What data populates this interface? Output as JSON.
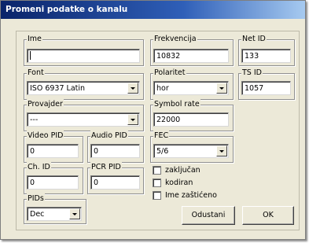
{
  "window": {
    "title": "Promeni podatke o kanalu"
  },
  "fields": {
    "ime": {
      "label": "Ime",
      "value": ""
    },
    "frekvencija": {
      "label": "Frekvencija",
      "value": "10832"
    },
    "net_id": {
      "label": "Net ID",
      "value": "133"
    },
    "font": {
      "label": "Font",
      "value": "ISO 6937 Latin"
    },
    "polaritet": {
      "label": "Polaritet",
      "value": "hor"
    },
    "ts_id": {
      "label": "TS ID",
      "value": "1057"
    },
    "provajder": {
      "label": "Provajder",
      "value": "---"
    },
    "symbol_rate": {
      "label": "Symbol rate",
      "value": "22000"
    },
    "video_pid": {
      "label": "Video PID",
      "value": "0"
    },
    "audio_pid": {
      "label": "Audio PID",
      "value": "0"
    },
    "fec": {
      "label": "FEC",
      "value": "5/6"
    },
    "ch_id": {
      "label": "Ch. ID",
      "value": "0"
    },
    "pcr_pid": {
      "label": "PCR PID",
      "value": "0"
    },
    "pids": {
      "label": "PIDs",
      "value": "Dec"
    }
  },
  "checkboxes": [
    {
      "label": "zaključan",
      "checked": false
    },
    {
      "label": "kodiran",
      "checked": false
    },
    {
      "label": "Ime zaštićeno",
      "checked": false
    }
  ],
  "buttons": {
    "cancel": "Odustani",
    "ok": "OK"
  }
}
